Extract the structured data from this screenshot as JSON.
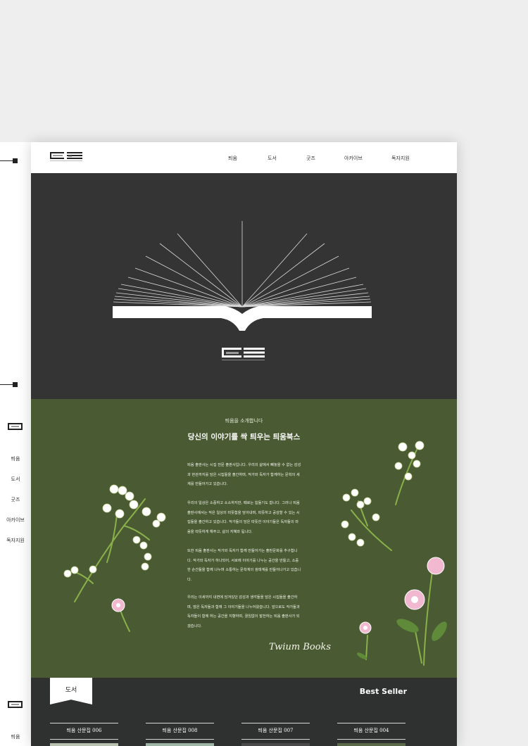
{
  "header": {
    "logo_text": "TWIUMBOOKS",
    "nav": [
      "틔움",
      "도서",
      "굿즈",
      "아카이브",
      "독자지원"
    ]
  },
  "sidebar": {
    "menu": [
      "틔움",
      "도서",
      "굿즈",
      "아카이브",
      "독자지원"
    ],
    "bottom_item": "틔움"
  },
  "intro": {
    "kicker": "틔움을 소개합니다",
    "title": "당신의 이야기를 싹 틔우는 틔움북스",
    "paragraphs": [
      "틔움 출판사는 시집 전문 출판사입니다. 우리의 삶에서 빼놓을 수 없는 감성과 현관까지를 담은 시집들을 출간하며, 작가와 독자가 함께하는 문학의 세계를 만들어가고 있습니다.",
      "우리의 일상은 소중하고 소소하지만, 때로는 힘들기도 합니다. 그러나 틔움 출판사에서는 작은 일상의 따뜻함을 담아내며, 따뜻하고 공감할 수 있는 시집들을 출간하고 있습니다. 작가들의 담은 따뜻한 이야기들은 독자들의 마음을 따뜻하게 해주고, 삶의 지혜와 됩니다.",
      "또한 틔움 출판사는 작가와 독자가 함께 만들어가는 출판문화를 추구합니다. 작가와 독자가 하나되어, 서로에 이야기를 나누는 공간을 만들고, 소중한 순간들을 함께 나누며 소통하는 문학계의 생태계를 만들어나가고 있습니다.",
      "우리는 이세까지 내면에 담겨있던 감성과 생각들을 담은 시집들을 출간하며, 많은 독자들과 함께 그 이야기들을 나누어왔습니다. 앞으로도 작가들과 독자들이 함께 하는 공간을 지향하며, 끊임없이 발전하는 틔움 출판사가 되겠습니다."
    ],
    "signature": "Twium Books"
  },
  "books": {
    "section_label": "도서",
    "best_label": "Best Seller",
    "items": [
      "틔움 산문집 006",
      "틔움 산문집 008",
      "틔움 산문집 007",
      "틔움 산문집 004"
    ]
  },
  "colors": {
    "hero_bg": "#333433",
    "intro_bg": "#4a5b33",
    "books_bg": "#2f3030",
    "flower_white": "#ffffff",
    "flower_pink": "#f2b8d0",
    "stem": "#8ab04a"
  }
}
